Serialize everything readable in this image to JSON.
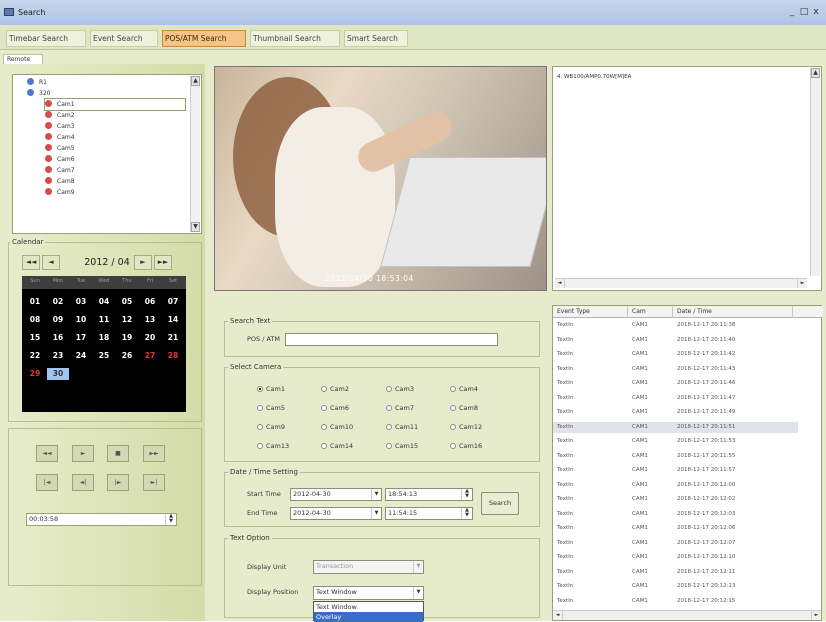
{
  "window": {
    "title": "Search",
    "min_label": "_",
    "max_label": "□",
    "close_label": "x"
  },
  "tabs": [
    {
      "label": "Timebar Search"
    },
    {
      "label": "Event Search"
    },
    {
      "label": "POS/ATM Search"
    },
    {
      "label": "Thumbnail Search"
    },
    {
      "label": "Smart Search"
    }
  ],
  "subtab": "Remote",
  "tree": {
    "nodes": [
      {
        "label": "R1"
      },
      {
        "label": "320"
      },
      {
        "label": "Cam1"
      },
      {
        "label": "Cam2"
      },
      {
        "label": "Cam3"
      },
      {
        "label": "Cam4"
      },
      {
        "label": "Cam5"
      },
      {
        "label": "Cam6"
      },
      {
        "label": "Cam7"
      },
      {
        "label": "Cam8"
      },
      {
        "label": "Cam9"
      }
    ]
  },
  "calendar": {
    "label": "Calendar",
    "month": "2012 / 04",
    "nav": [
      "◄◄",
      "◄",
      "►",
      "►►"
    ],
    "dow": [
      "Sun",
      "Mon",
      "Tue",
      "Wed",
      "Thu",
      "Fri",
      "Sat"
    ],
    "weeks": [
      [
        "01",
        "02",
        "03",
        "04",
        "05",
        "06",
        "07"
      ],
      [
        "08",
        "09",
        "10",
        "11",
        "12",
        "13",
        "14"
      ],
      [
        "15",
        "16",
        "17",
        "18",
        "19",
        "20",
        "21"
      ],
      [
        "22",
        "23",
        "24",
        "25",
        "26",
        "27",
        "28"
      ],
      [
        "29",
        "30",
        "",
        "",
        "",
        "",
        ""
      ]
    ]
  },
  "playback": {
    "row1": [
      "◄◄",
      "►",
      "■",
      "►►"
    ],
    "row2": [
      "|◄",
      "◄|",
      "|►",
      "►|"
    ],
    "time": "00:03:58",
    "spin_up": "▲",
    "spin_down": "▼"
  },
  "video": {
    "timestamp": "2012/04/30 18:53:04"
  },
  "text_window": {
    "line": "4. WB100/AMP0.70W[M]EA",
    "scroll_left": "◄",
    "scroll_right": "►",
    "scroll_up": "▲",
    "scroll_down": "▼"
  },
  "search_text": {
    "label": "Search Text",
    "pos_label": "POS / ATM",
    "pos_value": ""
  },
  "select_camera": {
    "label": "Select Camera",
    "cams": [
      "Cam1",
      "Cam2",
      "Cam3",
      "Cam4",
      "Cam5",
      "Cam6",
      "Cam7",
      "Cam8",
      "Cam9",
      "Cam10",
      "Cam11",
      "Cam12",
      "Cam13",
      "Cam14",
      "Cam15",
      "Cam16"
    ],
    "selected": "Cam1"
  },
  "date_time": {
    "label": "Date / Time Setting",
    "start_label": "Start Time",
    "start_date": "2012-04-30",
    "start_time": "18:54:13",
    "end_label": "End Time",
    "end_date": "2012-04-30",
    "end_time": "11:54:15",
    "search_label": "Search",
    "dd_arrow": "▼",
    "spin_up": "▲",
    "spin_down": "▼"
  },
  "text_option": {
    "label": "Text Option",
    "unit_label": "Display Unit",
    "unit_value": "Transaction",
    "position_label": "Display Position",
    "position_value": "Text Window",
    "position_options": [
      "Text Window",
      "Overlay"
    ]
  },
  "event_table": {
    "headers": [
      "Event Type",
      "Cam",
      "Date / Time"
    ],
    "rows": [
      [
        "TextIn",
        "CAM1",
        "2018-12-17 20:11:38"
      ],
      [
        "TextIn",
        "CAM1",
        "2018-12-17 20:11:40"
      ],
      [
        "TextIn",
        "CAM1",
        "2018-12-17 20:11:42"
      ],
      [
        "TextIn",
        "CAM1",
        "2018-12-17 20:11:43"
      ],
      [
        "TextIn",
        "CAM1",
        "2018-12-17 20:11:46"
      ],
      [
        "TextIn",
        "CAM1",
        "2018-12-17 20:11:47"
      ],
      [
        "TextIn",
        "CAM1",
        "2018-12-17 20:11:49"
      ],
      [
        "TextIn",
        "CAM1",
        "2018-12-17 20:11:51"
      ],
      [
        "TextIn",
        "CAM1",
        "2018-12-17 20:11:53"
      ],
      [
        "TextIn",
        "CAM1",
        "2018-12-17 20:11:55"
      ],
      [
        "TextIn",
        "CAM1",
        "2018-12-17 20:11:57"
      ],
      [
        "TextIn",
        "CAM1",
        "2018-12-17 20:12:00"
      ],
      [
        "TextIn",
        "CAM1",
        "2018-12-17 20:12:02"
      ],
      [
        "TextIn",
        "CAM1",
        "2018-12-17 20:12:03"
      ],
      [
        "TextIn",
        "CAM1",
        "2018-12-17 20:12:06"
      ],
      [
        "TextIn",
        "CAM1",
        "2018-12-17 20:12:07"
      ],
      [
        "TextIn",
        "CAM1",
        "2018-12-17 20:12:10"
      ],
      [
        "TextIn",
        "CAM1",
        "2018-12-17 20:12:11"
      ],
      [
        "TextIn",
        "CAM1",
        "2018-12-17 20:12:13"
      ],
      [
        "TextIn",
        "CAM1",
        "2018-12-17 20:12:15"
      ]
    ],
    "highlighted_row": 7,
    "scroll_left": "◄",
    "scroll_right": "►"
  }
}
